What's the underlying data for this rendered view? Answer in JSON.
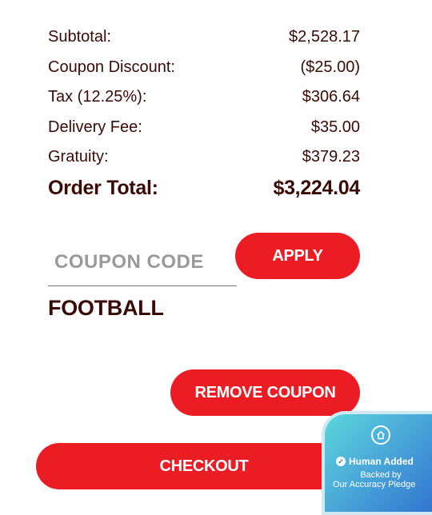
{
  "summary": {
    "rows": [
      {
        "label": "Subtotal:",
        "value": "$2,528.17"
      },
      {
        "label": "Coupon Discount:",
        "value": "($25.00)"
      },
      {
        "label": "Tax (12.25%):",
        "value": "$306.64"
      },
      {
        "label": "Delivery Fee:",
        "value": "$35.00"
      },
      {
        "label": "Gratuity:",
        "value": "$379.23"
      }
    ],
    "total_label": "Order Total:",
    "total_value": "$3,224.04"
  },
  "coupon": {
    "placeholder": "COUPON CODE",
    "apply_label": "APPLY",
    "applied_code": "FOOTBALL",
    "remove_label": "REMOVE COUPON"
  },
  "checkout": {
    "label": "CHECKOUT"
  },
  "badge": {
    "title": "Human Added",
    "line2": "Backed by",
    "line3": "Our Accuracy Pledge",
    "icon": "home-icon"
  },
  "colors": {
    "accent": "#ec1c24",
    "text": "#3a0a06"
  }
}
